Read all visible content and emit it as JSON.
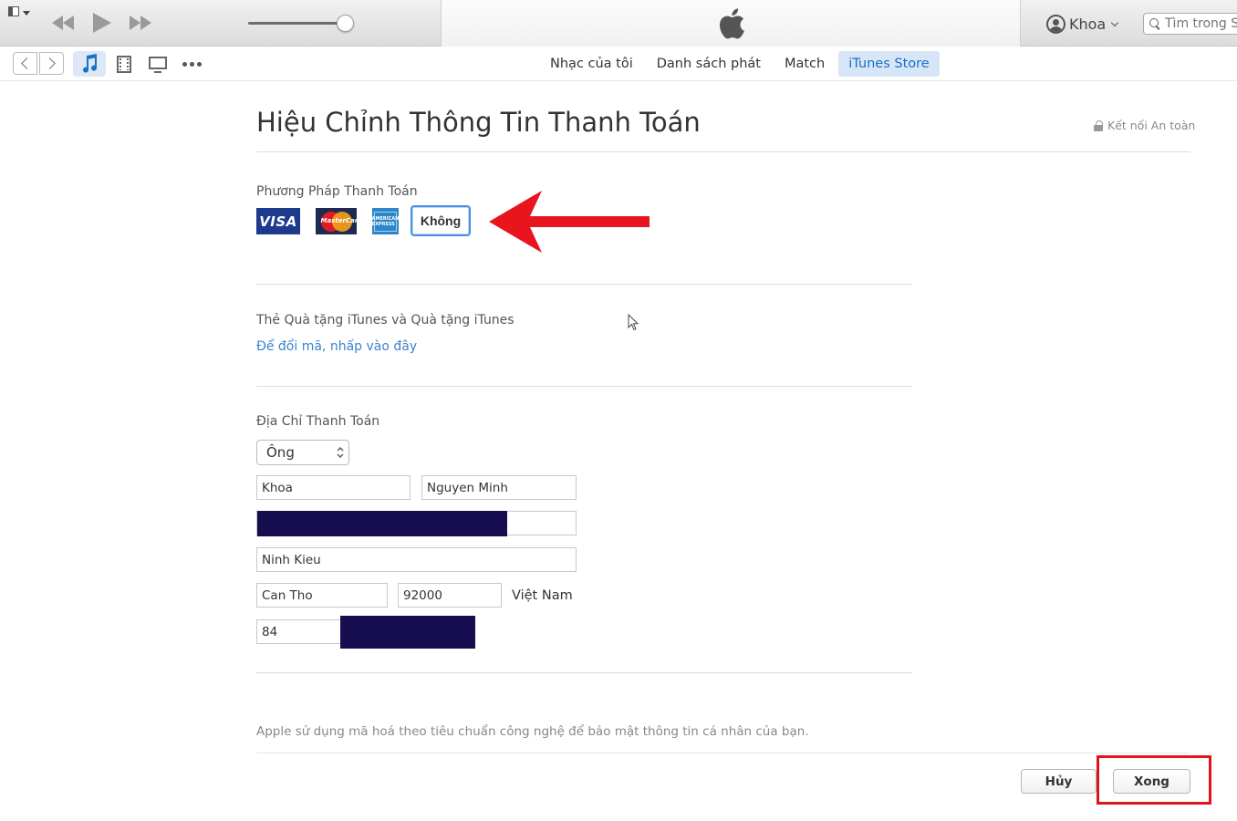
{
  "window": {
    "account_name": "Khoa",
    "search_placeholder": "Tìm trong S"
  },
  "nav": {
    "tabs": [
      {
        "label": "Nhạc của tôi",
        "active": false
      },
      {
        "label": "Danh sách phát",
        "active": false
      },
      {
        "label": "Match",
        "active": false
      },
      {
        "label": "iTunes Store",
        "active": true
      }
    ],
    "active_media": "music-note-icon"
  },
  "page": {
    "title": "Hiệu Chỉnh Thông Tin Thanh Toán",
    "secure_label": "Kết nối An toàn"
  },
  "payment": {
    "label": "Phương Pháp Thanh Toán",
    "cards": {
      "visa": "VISA",
      "mastercard": "MasterCard",
      "amex": "AMERICAN EXPRESS",
      "none": "Không"
    },
    "selected": "none"
  },
  "gift": {
    "label": "Thẻ Quà tặng iTunes và Quà tặng iTunes",
    "link": "Để đổi mã, nhấp vào đây"
  },
  "address": {
    "label": "Địa Chỉ Thanh Toán",
    "salutation": "Ông",
    "first_name": "Khoa",
    "last_name": "Nguyen Minh",
    "street1": "",
    "street2": "Ninh Kieu",
    "city": "Can Tho",
    "postal_code": "92000",
    "country": "Việt Nam",
    "area_code": "84"
  },
  "footer": {
    "privacy_note": "Apple sử dụng mã hoá theo tiêu chuẩn công nghệ để bảo mật thông tin cá nhân của bạn.",
    "cancel_label": "Hủy",
    "done_label": "Xong"
  },
  "colors": {
    "accent": "#3b82d0",
    "annotation_red": "#e0141e",
    "redaction": "#160e4f"
  }
}
